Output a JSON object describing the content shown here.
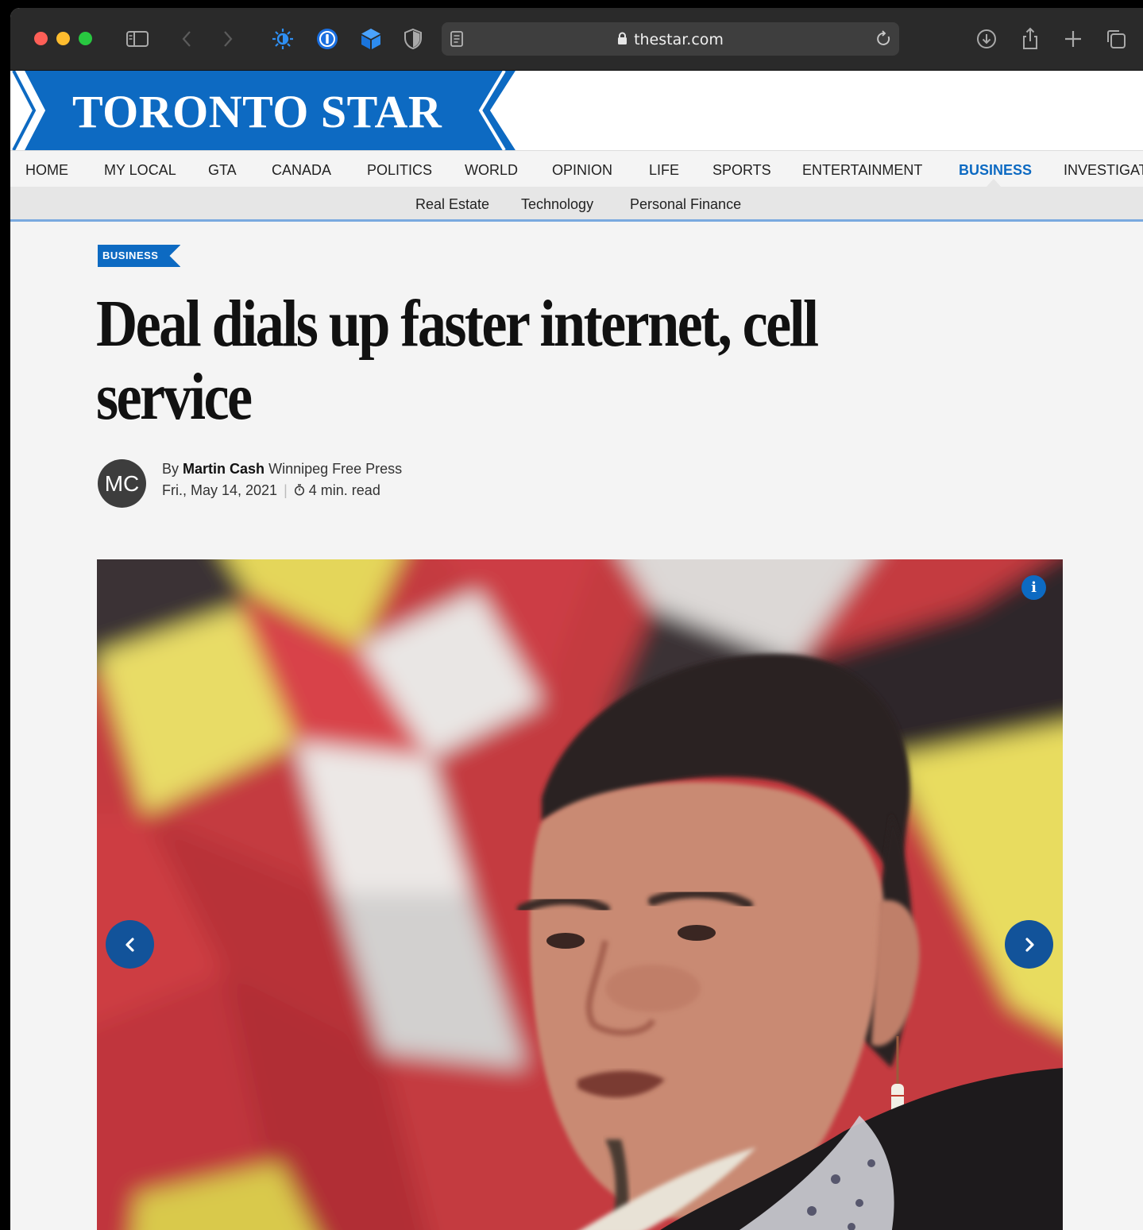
{
  "browser": {
    "url": "thestar.com"
  },
  "masthead": {
    "logo": "TORONTO STAR",
    "brand_color": "#0d6ac2"
  },
  "nav": {
    "items": [
      "HOME",
      "MY LOCAL",
      "GTA",
      "CANADA",
      "POLITICS",
      "WORLD",
      "OPINION",
      "LIFE",
      "SPORTS",
      "ENTERTAINMENT",
      "BUSINESS",
      "INVESTIGAT"
    ],
    "active": "BUSINESS"
  },
  "subnav": {
    "items": [
      "Real Estate",
      "Technology",
      "Personal Finance"
    ]
  },
  "article": {
    "section": "BUSINESS",
    "headline": "Deal dials up faster internet, cell service",
    "author_initials": "MC",
    "by": "By",
    "author": "Martin Cash",
    "publication": "Winnipeg Free Press",
    "date": "Fri., May 14, 2021",
    "read_time": "4 min. read"
  },
  "gallery": {
    "info_label": "i"
  }
}
